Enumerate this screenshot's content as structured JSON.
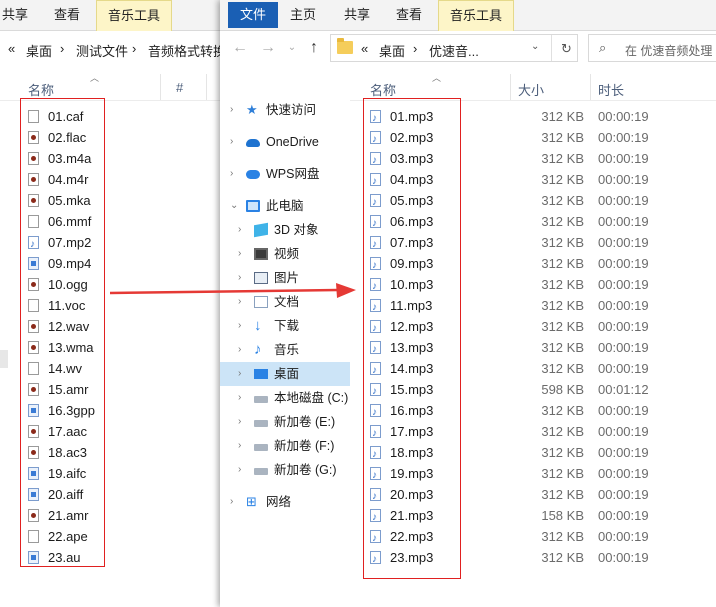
{
  "back_window": {
    "ribbon_tabs": [
      "共享",
      "查看",
      "音乐工具"
    ],
    "address": [
      "«",
      "桌面",
      "›",
      "测试文件",
      "›",
      "音频格式转换"
    ],
    "column_name": "名称",
    "column_hash": "#",
    "files": [
      {
        "name": "01.caf",
        "icon": "blank-file-icon"
      },
      {
        "name": "02.flac",
        "icon": "media-file-icon"
      },
      {
        "name": "03.m4a",
        "icon": "media-file-icon"
      },
      {
        "name": "04.m4r",
        "icon": "media-file-icon"
      },
      {
        "name": "05.mka",
        "icon": "media-file-icon"
      },
      {
        "name": "06.mmf",
        "icon": "blank-file-icon"
      },
      {
        "name": "07.mp2",
        "icon": "music-note-icon"
      },
      {
        "name": "09.mp4",
        "icon": "video-file-icon"
      },
      {
        "name": "10.ogg",
        "icon": "media-file-icon"
      },
      {
        "name": "11.voc",
        "icon": "blank-file-icon"
      },
      {
        "name": "12.wav",
        "icon": "media-file-icon"
      },
      {
        "name": "13.wma",
        "icon": "media-file-icon"
      },
      {
        "name": "14.wv",
        "icon": "blank-file-icon"
      },
      {
        "name": "15.amr",
        "icon": "media-file-icon"
      },
      {
        "name": "16.3gpp",
        "icon": "video-file-icon"
      },
      {
        "name": "17.aac",
        "icon": "media-file-icon"
      },
      {
        "name": "18.ac3",
        "icon": "media-file-icon"
      },
      {
        "name": "19.aifc",
        "icon": "video-file-icon"
      },
      {
        "name": "20.aiff",
        "icon": "video-file-icon"
      },
      {
        "name": "21.amr",
        "icon": "media-file-icon"
      },
      {
        "name": "22.ape",
        "icon": "blank-file-icon"
      },
      {
        "name": "23.au",
        "icon": "video-file-icon"
      }
    ]
  },
  "front_window": {
    "file_tab": "文件",
    "ribbon_tabs": [
      "主页",
      "共享",
      "查看",
      "音乐工具"
    ],
    "address": [
      "«",
      "桌面",
      "›",
      "优速音..."
    ],
    "search_placeholder": "在 优速音频处理",
    "nav": [
      {
        "label": "快速访问",
        "icon": "star-icon"
      },
      {
        "label": "OneDrive",
        "icon": "onedrive-cloud-icon"
      },
      {
        "label": "WPS网盘",
        "icon": "wps-cloud-icon"
      },
      {
        "label": "此电脑",
        "icon": "computer-icon"
      },
      {
        "label": "3D 对象",
        "icon": "3d-objects-icon"
      },
      {
        "label": "视频",
        "icon": "video-folder-icon"
      },
      {
        "label": "图片",
        "icon": "pictures-folder-icon"
      },
      {
        "label": "文档",
        "icon": "documents-folder-icon"
      },
      {
        "label": "下载",
        "icon": "download-arrow-icon"
      },
      {
        "label": "音乐",
        "icon": "music-folder-icon"
      },
      {
        "label": "桌面",
        "icon": "desktop-folder-icon"
      },
      {
        "label": "本地磁盘 (C:)",
        "icon": "local-disk-icon"
      },
      {
        "label": "新加卷 (E:)",
        "icon": "drive-icon"
      },
      {
        "label": "新加卷 (F:)",
        "icon": "drive-icon"
      },
      {
        "label": "新加卷 (G:)",
        "icon": "drive-icon"
      },
      {
        "label": "网络",
        "icon": "network-icon"
      }
    ],
    "columns": {
      "name": "名称",
      "size": "大小",
      "duration": "时长"
    },
    "files": [
      {
        "name": "01.mp3",
        "size": "312 KB",
        "duration": "00:00:19"
      },
      {
        "name": "02.mp3",
        "size": "312 KB",
        "duration": "00:00:19"
      },
      {
        "name": "03.mp3",
        "size": "312 KB",
        "duration": "00:00:19"
      },
      {
        "name": "04.mp3",
        "size": "312 KB",
        "duration": "00:00:19"
      },
      {
        "name": "05.mp3",
        "size": "312 KB",
        "duration": "00:00:19"
      },
      {
        "name": "06.mp3",
        "size": "312 KB",
        "duration": "00:00:19"
      },
      {
        "name": "07.mp3",
        "size": "312 KB",
        "duration": "00:00:19"
      },
      {
        "name": "09.mp3",
        "size": "312 KB",
        "duration": "00:00:19"
      },
      {
        "name": "10.mp3",
        "size": "312 KB",
        "duration": "00:00:19"
      },
      {
        "name": "11.mp3",
        "size": "312 KB",
        "duration": "00:00:19"
      },
      {
        "name": "12.mp3",
        "size": "312 KB",
        "duration": "00:00:19"
      },
      {
        "name": "13.mp3",
        "size": "312 KB",
        "duration": "00:00:19"
      },
      {
        "name": "14.mp3",
        "size": "312 KB",
        "duration": "00:00:19"
      },
      {
        "name": "15.mp3",
        "size": "598 KB",
        "duration": "00:01:12"
      },
      {
        "name": "16.mp3",
        "size": "312 KB",
        "duration": "00:00:19"
      },
      {
        "name": "17.mp3",
        "size": "312 KB",
        "duration": "00:00:19"
      },
      {
        "name": "18.mp3",
        "size": "312 KB",
        "duration": "00:00:19"
      },
      {
        "name": "19.mp3",
        "size": "312 KB",
        "duration": "00:00:19"
      },
      {
        "name": "20.mp3",
        "size": "312 KB",
        "duration": "00:00:19"
      },
      {
        "name": "21.mp3",
        "size": "158 KB",
        "duration": "00:00:19"
      },
      {
        "name": "22.mp3",
        "size": "312 KB",
        "duration": "00:00:19"
      },
      {
        "name": "23.mp3",
        "size": "312 KB",
        "duration": "00:00:19"
      }
    ]
  },
  "colors": {
    "highlight_box": "#e02020",
    "arrow": "#e53935",
    "file_tab_bg": "#1a5fb4",
    "music_tab_bg": "#fdf5c8",
    "selected_nav": "#cce4f7"
  }
}
